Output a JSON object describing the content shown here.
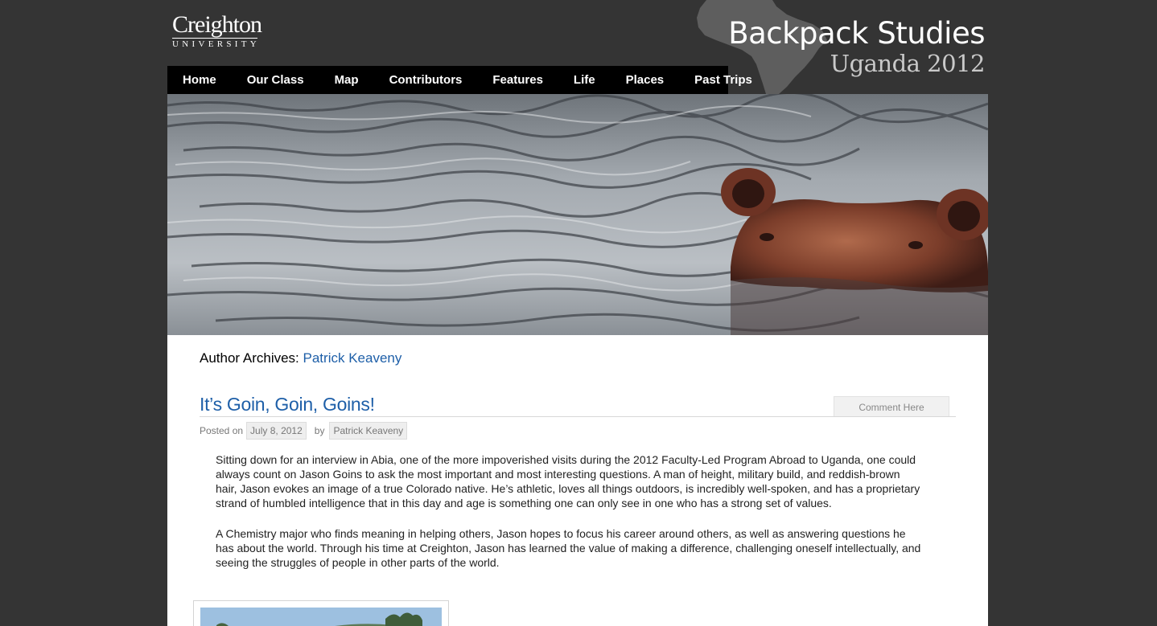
{
  "logo": {
    "name": "Creighton",
    "subtitle": "UNIVERSITY"
  },
  "site": {
    "title": "Backpack Studies",
    "subtitle": "Uganda 2012"
  },
  "nav": {
    "items": [
      "Home",
      "Our Class",
      "Map",
      "Contributors",
      "Features",
      "Life",
      "Places",
      "Past Trips"
    ]
  },
  "archive": {
    "prefix": "Author Archives:",
    "author": "Patrick Keaveny"
  },
  "post": {
    "title": "It’s Goin, Goin, Goins!",
    "comment_label": "Comment Here",
    "posted_on_label": "Posted on",
    "date": "July 8, 2012",
    "by_label": "by",
    "author": "Patrick Keaveny",
    "paragraphs": [
      "Sitting down for an interview in Abia, one of the more impoverished visits during the 2012 Faculty-Led Program Abroad to Uganda, one could always count on Jason Goins to ask the most important and most interesting questions. A man of height, military build, and reddish-brown hair, Jason evokes an image of a true Colorado native. He’s athletic, loves all things outdoors, is incredibly well-spoken, and has a proprietary strand of humbled intelligence that in this day and age is something one can only see in one who has a strong set of values.",
      "A Chemistry major who finds meaning in helping others, Jason hopes to focus his career around others, as well as answering questions he has about the world.  Through his time at Creighton, Jason has learned the value of making a difference, challenging oneself intellectually, and seeing the struggles of people in other parts of the world."
    ]
  },
  "colors": {
    "background": "#343434",
    "nav": "#000000",
    "link": "#1e5fa8"
  }
}
